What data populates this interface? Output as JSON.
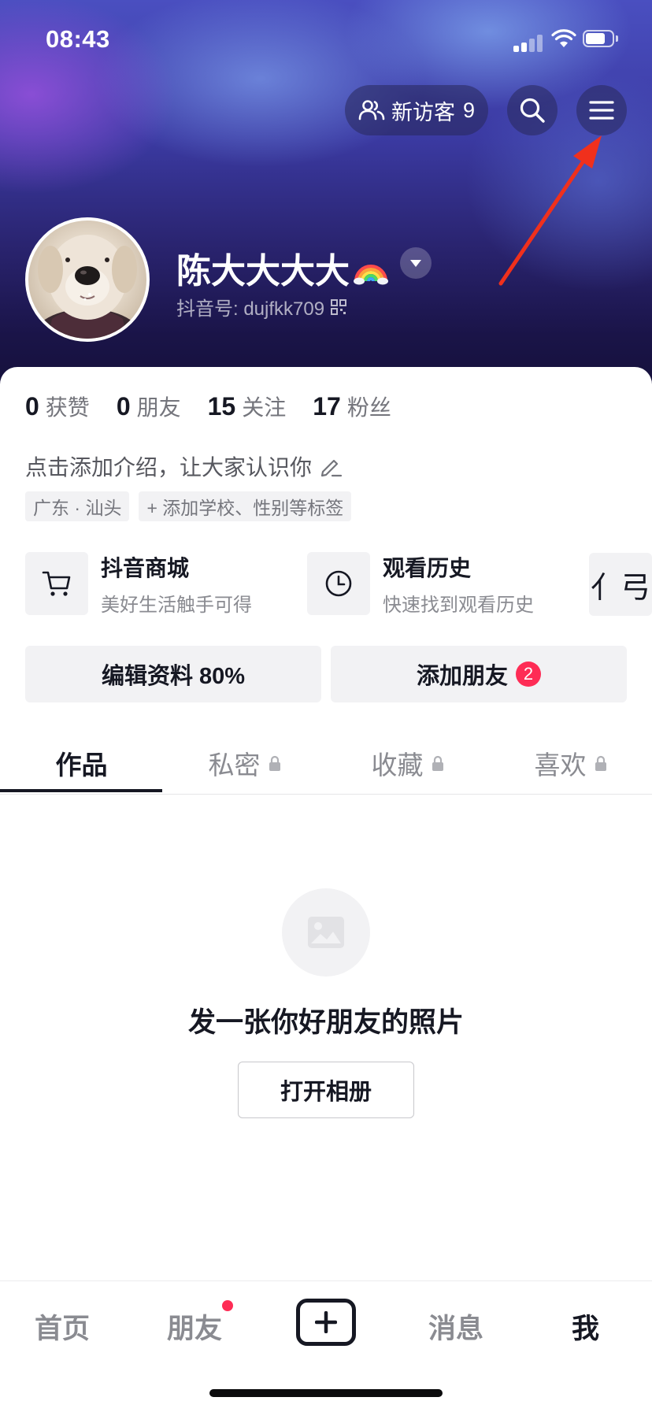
{
  "status_bar": {
    "time": "08:43",
    "battery_level": 0.75
  },
  "header": {
    "visitors_label": "新访客",
    "visitors_count": "9",
    "search_icon": "search-icon",
    "menu_icon": "menu-icon"
  },
  "profile": {
    "name": "陈大大大大",
    "name_emoji": "rainbow",
    "id_label": "抖音号: dujfkk709"
  },
  "stats": [
    {
      "value": "0",
      "label": "获赞"
    },
    {
      "value": "0",
      "label": "朋友"
    },
    {
      "value": "15",
      "label": "关注"
    },
    {
      "value": "17",
      "label": "粉丝"
    }
  ],
  "bio": "点击添加介绍，让大家认识你",
  "tags": [
    "广东 · 汕头",
    "+ 添加学校、性别等标签"
  ],
  "services": [
    {
      "title": "抖音商城",
      "subtitle": "美好生活触手可得",
      "icon": "cart-icon"
    },
    {
      "title": "观看历史",
      "subtitle": "快速找到观看历史",
      "icon": "clock-icon"
    }
  ],
  "services_more_glyph": "亻弓",
  "actions": {
    "edit_profile": "编辑资料 80%",
    "add_friend": "添加朋友",
    "add_friend_badge": "2"
  },
  "tabs": [
    "作品",
    "私密",
    "收藏",
    "喜欢"
  ],
  "empty_state": {
    "title": "发一张你好朋友的照片",
    "button": "打开相册"
  },
  "bottom_nav": [
    "首页",
    "朋友",
    "消息",
    "我"
  ],
  "colors": {
    "accent": "#fe2c55",
    "text": "#161823",
    "muted": "#8a8b91"
  }
}
